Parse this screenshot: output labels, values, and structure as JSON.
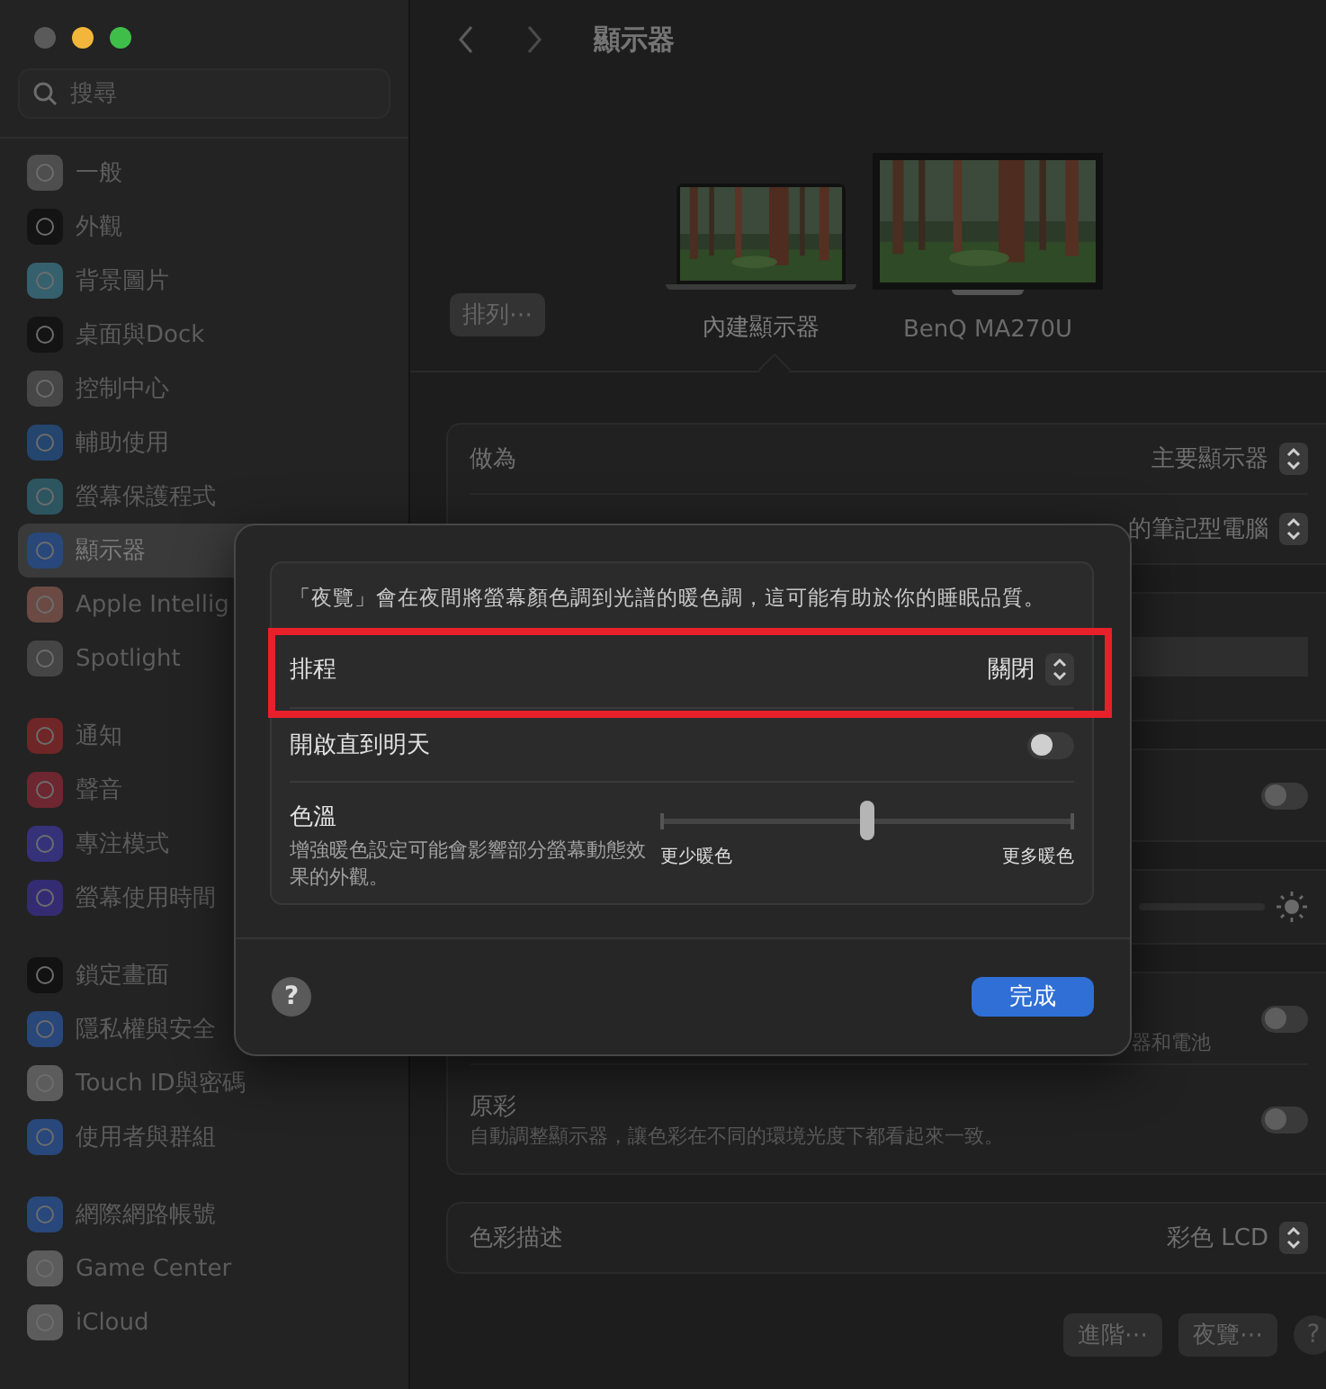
{
  "window": {
    "traffic_lights": [
      {
        "color": "#5a5a5a"
      },
      {
        "color": "#f2b73a"
      },
      {
        "color": "#3fbf4a"
      }
    ]
  },
  "sidebar": {
    "search": {
      "placeholder": "搜尋"
    },
    "groups": [
      {
        "items": [
          {
            "label": "一般",
            "color": "#4e4e4e",
            "selected": false
          },
          {
            "label": "外觀",
            "color": "#141414",
            "selected": false
          },
          {
            "label": "背景圖片",
            "color": "#35606e",
            "selected": false
          },
          {
            "label": "桌面與Dock",
            "color": "#141414",
            "selected": false
          },
          {
            "label": "控制中心",
            "color": "#474747",
            "selected": false
          },
          {
            "label": "輔助使用",
            "color": "#24456e",
            "selected": false
          },
          {
            "label": "螢幕保護程式",
            "color": "#2c5560",
            "selected": false
          },
          {
            "label": "顯示器",
            "color": "#28477a",
            "selected": true
          },
          {
            "label": "Apple Intellig",
            "color": "#6b4a44",
            "selected": false
          },
          {
            "label": "Spotlight",
            "color": "#454545",
            "selected": false
          }
        ]
      },
      {
        "items": [
          {
            "label": "通知",
            "color": "#6e2626",
            "selected": false
          },
          {
            "label": "聲音",
            "color": "#6e2630",
            "selected": false
          },
          {
            "label": "專注模式",
            "color": "#35327a",
            "selected": false
          },
          {
            "label": "螢幕使用時間",
            "color": "#342c72",
            "selected": false
          }
        ]
      },
      {
        "items": [
          {
            "label": "鎖定畫面",
            "color": "#121212",
            "selected": false
          },
          {
            "label": "隱私權與安全",
            "color": "#28477a",
            "selected": false
          },
          {
            "label": "Touch ID與密碼",
            "color": "#5c5c5c",
            "selected": false
          },
          {
            "label": "使用者與群組",
            "color": "#28477a",
            "selected": false
          }
        ]
      },
      {
        "items": [
          {
            "label": "網際網路帳號",
            "color": "#28477a",
            "selected": false
          },
          {
            "label": "Game Center",
            "color": "#5c5c5c",
            "selected": false
          },
          {
            "label": "iCloud",
            "color": "#5c5c5c",
            "selected": false
          }
        ]
      }
    ]
  },
  "main": {
    "title": "顯示器",
    "arrange_button": "排列⋯",
    "displays": [
      {
        "kind": "laptop",
        "label": "內建顯示器",
        "selected": true
      },
      {
        "kind": "monitor",
        "label": "BenQ MA270U",
        "selected": false
      }
    ],
    "panels": [
      {
        "rows": [
          {
            "kind": "select",
            "label": "做為",
            "value": "主要顯示器"
          },
          {
            "kind": "select",
            "value": "的筆記型電腦"
          }
        ]
      },
      {
        "rows": [
          {
            "kind": "bar"
          }
        ]
      },
      {
        "rows": [
          {
            "kind": "toggle",
            "on": false
          }
        ]
      },
      {
        "rows": [
          {
            "kind": "slider"
          }
        ]
      },
      {
        "rows": [
          {
            "kind": "toggle",
            "subtitle": "器和電池",
            "on": false
          },
          {
            "kind": "toggle",
            "label": "原彩",
            "subtitle": "自動調整顯示器，讓色彩在不同的環境光度下都看起來一致。",
            "on": false
          }
        ]
      },
      {
        "rows": [
          {
            "kind": "select",
            "label": "色彩描述",
            "value": "彩色 LCD"
          }
        ]
      }
    ],
    "footer_buttons": [
      "進階⋯",
      "夜覽⋯"
    ],
    "help": "?"
  },
  "dialog": {
    "description": "「夜覽」會在夜間將螢幕顏色調到光譜的暖色調，這可能有助於你的睡眠品質。",
    "rows": [
      {
        "kind": "select",
        "label": "排程",
        "value": "關閉",
        "highlighted": true
      },
      {
        "kind": "toggle",
        "label": "開啟直到明天",
        "on": false
      },
      {
        "kind": "slider",
        "label": "色溫",
        "subtitle": "增強暖色設定可能會影響部分螢幕動態效果的外觀。",
        "level": 0.5,
        "min_label": "更少暖色",
        "max_label": "更多暖色"
      }
    ],
    "help": "?",
    "done_button": "完成"
  }
}
